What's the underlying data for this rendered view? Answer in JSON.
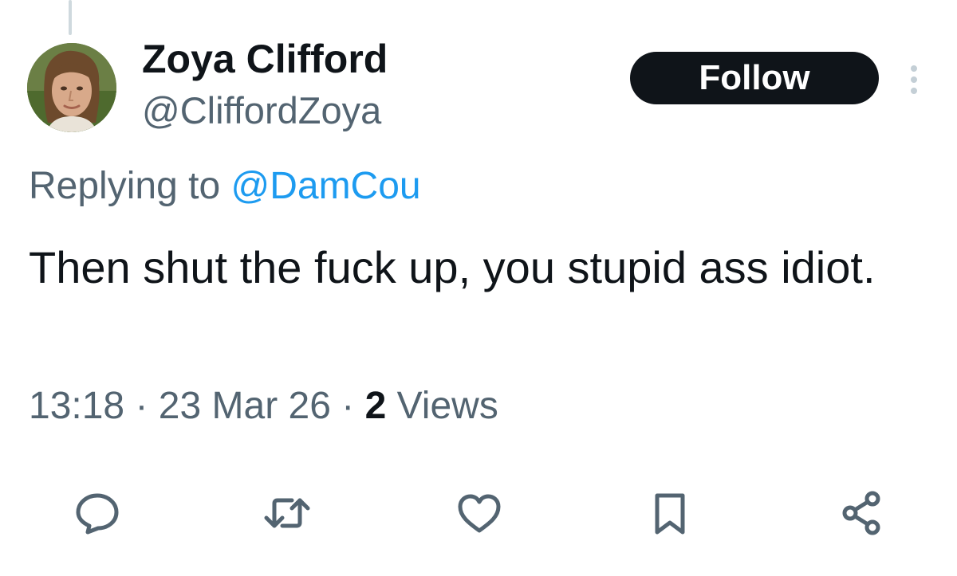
{
  "tweet": {
    "author": {
      "display_name": "Zoya Clifford",
      "handle": "@CliffordZoya"
    },
    "follow_label": "Follow",
    "replying_prefix": "Replying to",
    "replying_to": "@DamCou",
    "text": "Then shut the fuck up, you stupid ass idiot.",
    "time": "13:18",
    "separator": "·",
    "date": "23 Mar 26",
    "views_count": "2",
    "views_label": "Views"
  },
  "actions": {
    "icons": [
      "reply-icon",
      "retweet-icon",
      "like-icon",
      "bookmark-icon",
      "share-icon"
    ]
  },
  "colors": {
    "text_primary": "#0f1419",
    "text_secondary": "#536471",
    "link": "#1d9bf0",
    "button_bg": "#0f1419",
    "button_text": "#ffffff",
    "thread_line": "#cfd9de"
  }
}
